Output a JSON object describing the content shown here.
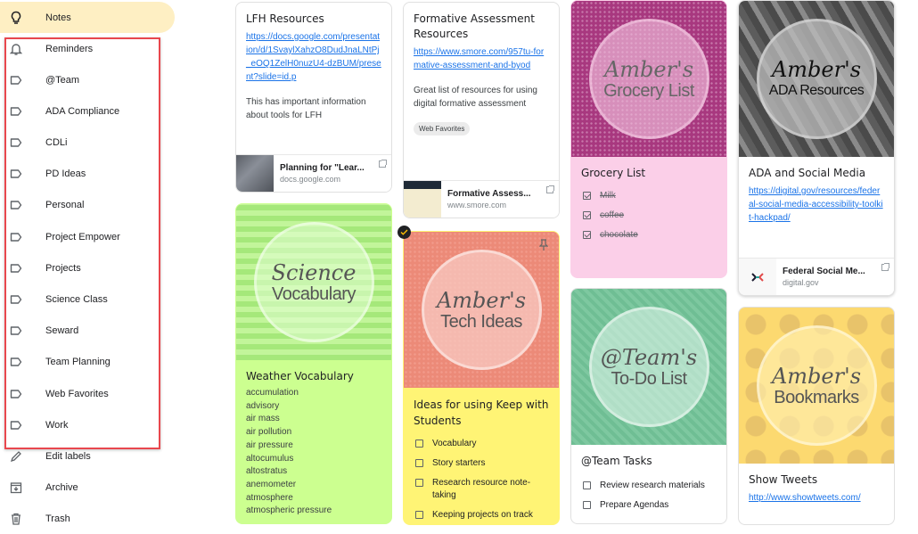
{
  "sidebar": {
    "items": [
      {
        "label": "Notes",
        "icon": "lightbulb-icon",
        "active": true
      },
      {
        "label": "Reminders",
        "icon": "bell-icon"
      },
      {
        "label": "@Team",
        "icon": "label-icon"
      },
      {
        "label": "ADA Compliance",
        "icon": "label-icon"
      },
      {
        "label": "CDLi",
        "icon": "label-icon"
      },
      {
        "label": "PD Ideas",
        "icon": "label-icon"
      },
      {
        "label": "Personal",
        "icon": "label-icon"
      },
      {
        "label": "Project Empower",
        "icon": "label-icon"
      },
      {
        "label": "Projects",
        "icon": "label-icon"
      },
      {
        "label": "Science Class",
        "icon": "label-icon"
      },
      {
        "label": "Seward",
        "icon": "label-icon"
      },
      {
        "label": "Team Planning",
        "icon": "label-icon"
      },
      {
        "label": "Web Favorites",
        "icon": "label-icon"
      },
      {
        "label": "Work",
        "icon": "label-icon"
      },
      {
        "label": "Edit labels",
        "icon": "pencil-icon"
      },
      {
        "label": "Archive",
        "icon": "archive-icon"
      },
      {
        "label": "Trash",
        "icon": "trash-icon"
      }
    ],
    "highlight_color": "#e8474e"
  },
  "notes": {
    "lfh": {
      "title": "LFH Resources",
      "link": "https://docs.google.com/presentation/d/1SvaylXahzO8DudJnaLNtPj_eOQ1ZelH0nuzU4-dzBUM/present?slide=id.p",
      "description": "This has important information about tools for LFH",
      "preview_title": "Planning for \"Lear...",
      "preview_domain": "docs.google.com"
    },
    "formative": {
      "title": "Formative Assessment Resources",
      "link": "https://www.smore.com/957tu-formative-assessment-and-byod",
      "description": "Great list of resources for using digital formative assessment",
      "label_chip": "Web Favorites",
      "preview_title": "Formative Assess...",
      "preview_domain": "www.smore.com"
    },
    "grocery": {
      "banner_script": "Amber's",
      "banner_sub": "Grocery List",
      "title": "Grocery List",
      "items": [
        {
          "text": "Milk",
          "checked": true
        },
        {
          "text": "coffee",
          "checked": true
        },
        {
          "text": "chocolate",
          "checked": true
        }
      ],
      "color": "#fbcfe8"
    },
    "ada": {
      "banner_script": "Amber's",
      "banner_sub": "ADA Resources",
      "title": "ADA and Social Media",
      "link": "https://digital.gov/resources/federal-social-media-accessibility-toolkit-hackpad/",
      "preview_title": "Federal Social Me...",
      "preview_domain": "digital.gov"
    },
    "science": {
      "banner_script": "Science",
      "banner_sub": "Vocabulary",
      "title": "Weather Vocabulary",
      "lines": [
        "accumulation",
        "advisory",
        "air mass",
        "air pollution",
        "air pressure",
        "altocumulus",
        "altostratus",
        "anemometer",
        "atmosphere",
        "atmospheric pressure"
      ],
      "color": "#ccff90"
    },
    "tech": {
      "banner_script": "Amber's",
      "banner_sub": "Tech Ideas",
      "title": "Ideas for using Keep with Students",
      "items": [
        {
          "text": "Vocabulary",
          "checked": false
        },
        {
          "text": "Story starters",
          "checked": false
        },
        {
          "text": "Research resource note-taking",
          "checked": false
        },
        {
          "text": "Keeping projects on track",
          "checked": false
        }
      ],
      "color": "#fff475"
    },
    "team": {
      "banner_script": "@Team's",
      "banner_sub": "To-Do List",
      "title": "@Team Tasks",
      "items": [
        {
          "text": "Review research materials",
          "checked": false
        },
        {
          "text": "Prepare Agendas",
          "checked": false
        }
      ]
    },
    "bookmarks": {
      "banner_script": "Amber's",
      "banner_sub": "Bookmarks",
      "title": "Show Tweets",
      "link": "http://www.showtweets.com/"
    }
  }
}
